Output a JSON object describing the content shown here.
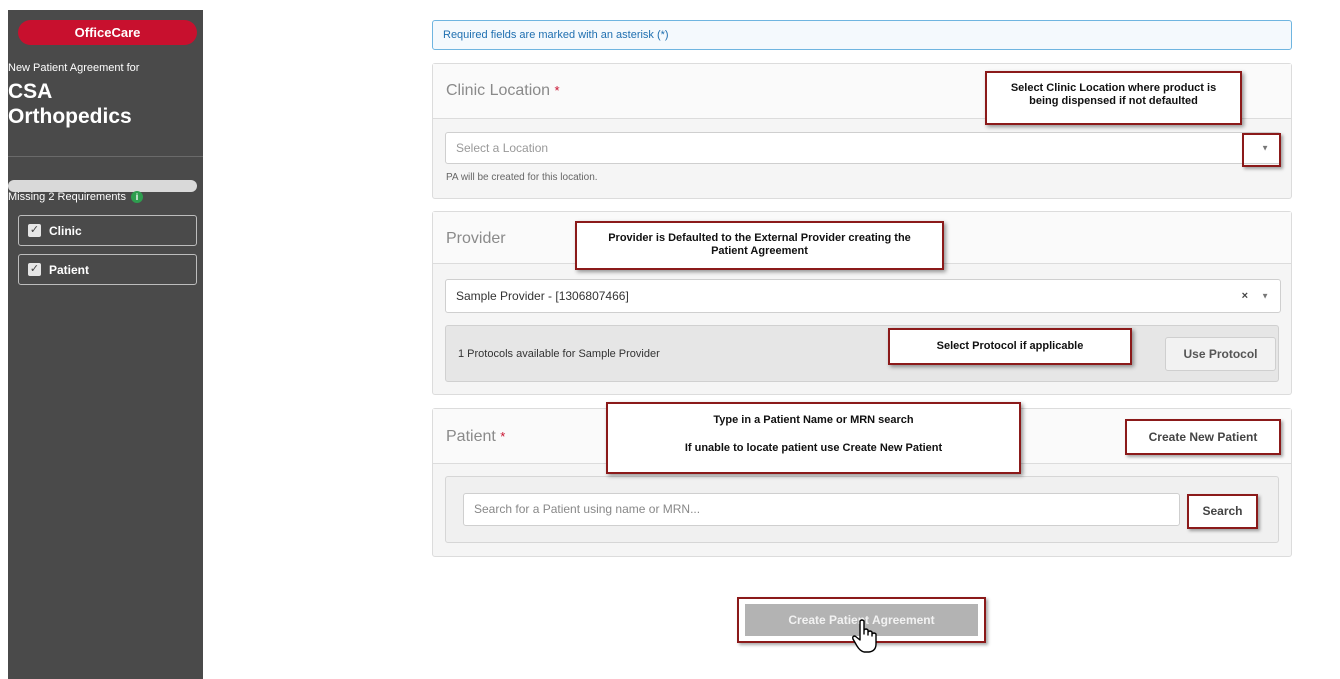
{
  "sidebar": {
    "brand": "OfficeCare",
    "subtitle": "New Patient Agreement for",
    "title_line1": "CSA",
    "title_line2": "Orthopedics",
    "progress": 0,
    "missing": "Missing 2 Requirements",
    "requirements": [
      {
        "label": "Clinic",
        "checked": true
      },
      {
        "label": "Patient",
        "checked": true
      }
    ]
  },
  "banner": "Required fields are marked with an asterisk (*)",
  "clinic": {
    "label": "Clinic Location",
    "star": "*",
    "placeholder": "Select a Location",
    "help": "PA will be created for this location."
  },
  "provider": {
    "label": "Provider",
    "selected": "Sample Provider - [1306807466]",
    "clear": "×",
    "protocols_text": "1 Protocols available for Sample Provider",
    "use_protocol": "Use Protocol"
  },
  "patient": {
    "label": "Patient",
    "star": "*",
    "create_new": "Create New Patient",
    "search_placeholder": "Search for a Patient using name or MRN...",
    "search_button": "Search"
  },
  "create_agreement": "Create Patient Agreement",
  "annotations": {
    "clinic_line1": "Select Clinic Location where product is",
    "clinic_line2": "being dispensed if not  defaulted",
    "provider_line1": "Provider is Defaulted to the External Provider creating the",
    "provider_line2": "Patient Agreement",
    "protocol": "Select Protocol if applicable",
    "patient_line1": "Type in a Patient Name or MRN search",
    "patient_line2": "If unable to locate patient use Create New Patient"
  },
  "icons": {
    "info": "info-icon",
    "check": "checkbox-checked-icon",
    "dropdown": "chevron-down-icon",
    "cursor": "hand-pointer-icon"
  },
  "colors": {
    "brand": "#c8102e",
    "sidebar": "#4a4a4a",
    "annotation_border": "#8b1a1a",
    "info_banner": "#1f6fb0"
  }
}
